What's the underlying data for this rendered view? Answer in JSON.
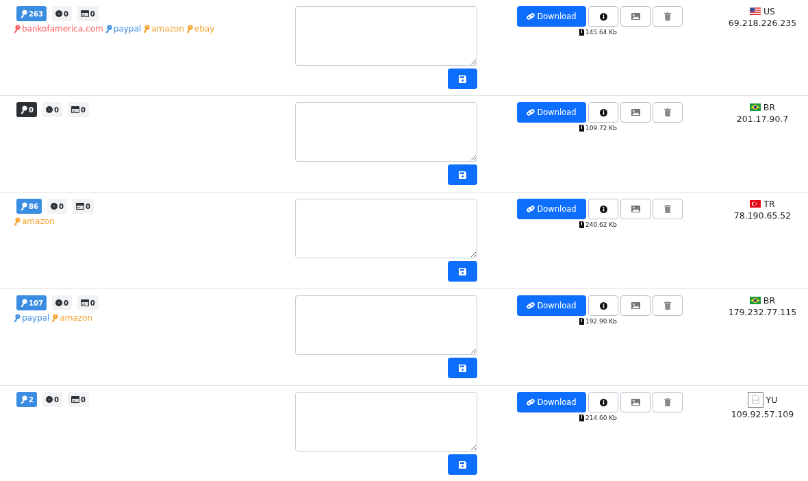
{
  "rows": [
    {
      "keys": {
        "count": "263",
        "active": true
      },
      "coins": "0",
      "cards": "0",
      "sites": [
        {
          "name": "bankofamerica.com",
          "color": "#ff5a5f"
        },
        {
          "name": "paypal",
          "color": "#3a8de0"
        },
        {
          "name": "amazon",
          "color": "#f5a02a"
        },
        {
          "name": "ebay",
          "color": "#f5a02a"
        }
      ],
      "download": "Download",
      "size": "145.64 Kb",
      "flag": {
        "kind": "us"
      },
      "country": "US",
      "ip": "69.218.226.235"
    },
    {
      "keys": {
        "count": "0",
        "active": false
      },
      "coins": "0",
      "cards": "0",
      "sites": [],
      "download": "Download",
      "size": "109.72 Kb",
      "flag": {
        "kind": "br"
      },
      "country": "BR",
      "ip": "201.17.90.7"
    },
    {
      "keys": {
        "count": "86",
        "active": true
      },
      "coins": "0",
      "cards": "0",
      "sites": [
        {
          "name": "amazon",
          "color": "#f5a02a"
        }
      ],
      "download": "Download",
      "size": "240.62 Kb",
      "flag": {
        "kind": "tr"
      },
      "country": "TR",
      "ip": "78.190.65.52"
    },
    {
      "keys": {
        "count": "107",
        "active": true
      },
      "coins": "0",
      "cards": "0",
      "sites": [
        {
          "name": "paypal",
          "color": "#3a8de0"
        },
        {
          "name": "amazon",
          "color": "#f5a02a"
        }
      ],
      "download": "Download",
      "size": "192.90 Kb",
      "flag": {
        "kind": "br"
      },
      "country": "BR",
      "ip": "179.232.77.115"
    },
    {
      "keys": {
        "count": "2",
        "active": true
      },
      "coins": "0",
      "cards": "0",
      "sites": [],
      "download": "Download",
      "size": "214.60 Kb",
      "flag": {
        "kind": "missing"
      },
      "country": "YU",
      "ip": "109.92.57.109"
    }
  ]
}
